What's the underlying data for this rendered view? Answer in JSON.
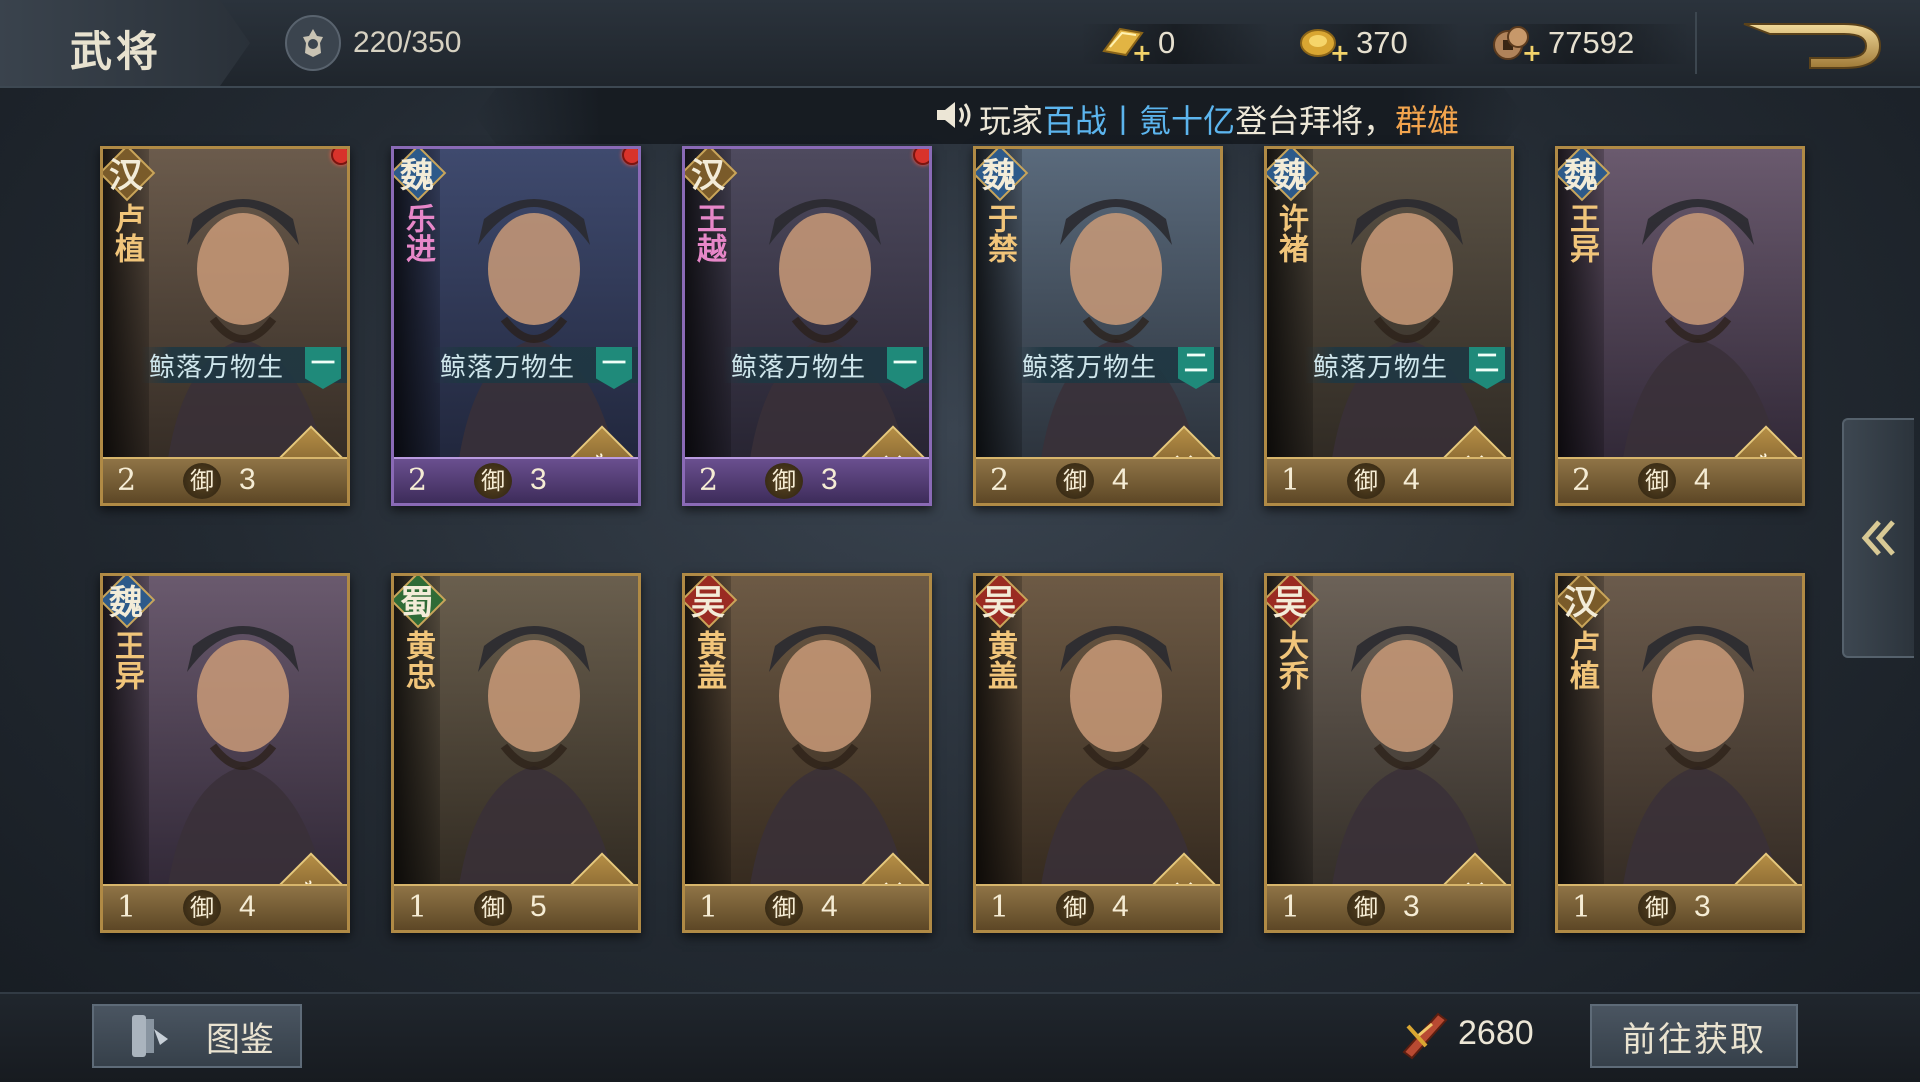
{
  "header": {
    "title": "武将",
    "capacity": "220/350",
    "resources": [
      {
        "name": "gold-bar",
        "value": "0"
      },
      {
        "name": "gold-coin",
        "value": "370"
      },
      {
        "name": "copper-coin",
        "value": "77592"
      }
    ]
  },
  "marquee": {
    "prefix": "玩家",
    "player": "百战",
    "sep": "丨",
    "player2": "氪十亿",
    "action": "登台拜将，",
    "faction": "群雄"
  },
  "cards": [
    {
      "faction": "汉",
      "name": "卢植",
      "skin": "鲸落万物生",
      "tier": "一",
      "star": "2",
      "yu": "御",
      "cost": "3",
      "troop": "bow",
      "rarity": "gold",
      "dot": true
    },
    {
      "faction": "魏",
      "name": "乐进",
      "skin": "鲸落万物生",
      "tier": "一",
      "star": "2",
      "yu": "御",
      "cost": "3",
      "troop": "cavalry",
      "rarity": "purple",
      "dot": true
    },
    {
      "faction": "汉",
      "name": "王越",
      "skin": "鲸落万物生",
      "tier": "一",
      "star": "2",
      "yu": "御",
      "cost": "3",
      "troop": "spear",
      "rarity": "purple",
      "dot": true
    },
    {
      "faction": "魏",
      "name": "于禁",
      "skin": "鲸落万物生",
      "tier": "二",
      "star": "2",
      "yu": "御",
      "cost": "4",
      "troop": "spear",
      "rarity": "gold",
      "dot": false
    },
    {
      "faction": "魏",
      "name": "许褚",
      "skin": "鲸落万物生",
      "tier": "二",
      "star": "1",
      "yu": "御",
      "cost": "4",
      "troop": "spear",
      "rarity": "gold",
      "dot": false
    },
    {
      "faction": "魏",
      "name": "王异",
      "skin": "",
      "tier": "",
      "star": "2",
      "yu": "御",
      "cost": "4",
      "troop": "cavalry",
      "rarity": "gold",
      "dot": false
    },
    {
      "faction": "魏",
      "name": "王异",
      "skin": "",
      "tier": "",
      "star": "1",
      "yu": "御",
      "cost": "4",
      "troop": "cavalry",
      "rarity": "gold",
      "dot": false
    },
    {
      "faction": "蜀",
      "name": "黄忠",
      "skin": "",
      "tier": "",
      "star": "1",
      "yu": "御",
      "cost": "5",
      "troop": "bow",
      "rarity": "gold",
      "dot": false
    },
    {
      "faction": "吴",
      "name": "黄盖",
      "skin": "",
      "tier": "",
      "star": "1",
      "yu": "御",
      "cost": "4",
      "troop": "spear",
      "rarity": "gold",
      "dot": false
    },
    {
      "faction": "吴",
      "name": "黄盖",
      "skin": "",
      "tier": "",
      "star": "1",
      "yu": "御",
      "cost": "4",
      "troop": "spear",
      "rarity": "gold",
      "dot": false
    },
    {
      "faction": "吴",
      "name": "大乔",
      "skin": "",
      "tier": "",
      "star": "1",
      "yu": "御",
      "cost": "3",
      "troop": "spear",
      "rarity": "gold",
      "dot": false
    },
    {
      "faction": "汉",
      "name": "卢植",
      "skin": "",
      "tier": "",
      "star": "1",
      "yu": "御",
      "cost": "3",
      "troop": "bow",
      "rarity": "gold",
      "dot": false
    }
  ],
  "bottom": {
    "tujian_label": "图鉴",
    "token_value": "2680",
    "get_label": "前往获取"
  }
}
